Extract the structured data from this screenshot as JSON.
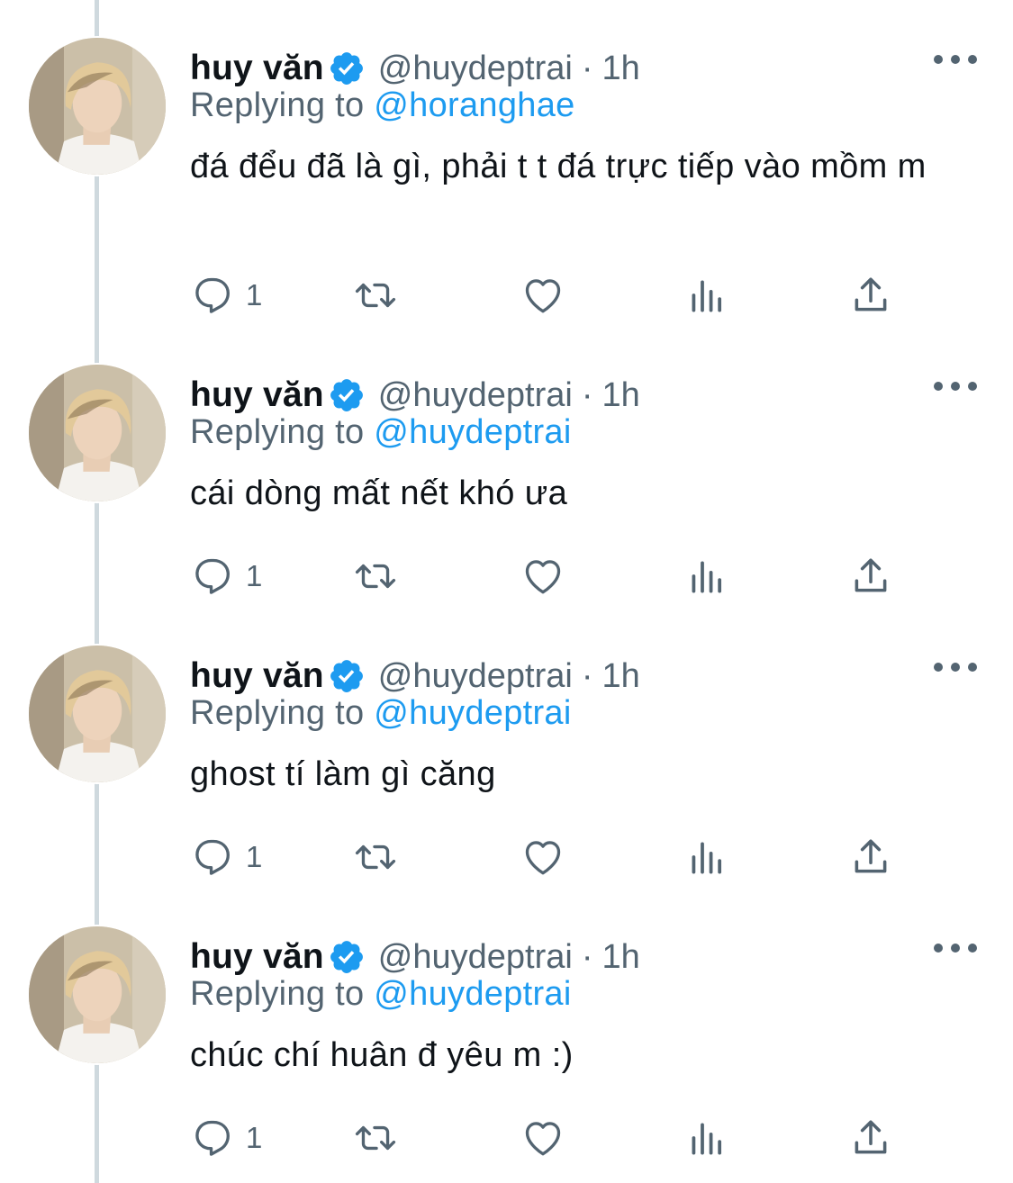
{
  "tweets": [
    {
      "display_name": "huy văn",
      "handle": "@huydeptrai",
      "separator": "·",
      "time": "1h",
      "replying_label": "Replying to",
      "replying_to": "@horanghae",
      "text": "đá đểu đã là gì, phải t t đá trực tiếp vào mồm m",
      "reply_count": "1"
    },
    {
      "display_name": "huy văn",
      "handle": "@huydeptrai",
      "separator": "·",
      "time": "1h",
      "replying_label": "Replying to",
      "replying_to": "@huydeptrai",
      "text": "cái dòng mất nết khó ưa",
      "reply_count": "1"
    },
    {
      "display_name": "huy văn",
      "handle": "@huydeptrai",
      "separator": "·",
      "time": "1h",
      "replying_label": "Replying to",
      "replying_to": "@huydeptrai",
      "text": "ghost tí làm gì căng",
      "reply_count": "1"
    },
    {
      "display_name": "huy văn",
      "handle": "@huydeptrai",
      "separator": "·",
      "time": "1h",
      "replying_label": "Replying to",
      "replying_to": "@huydeptrai",
      "text": "chúc chí huân đ yêu m :)",
      "reply_count": "1"
    }
  ],
  "icons": {
    "verified": "verified-badge-icon",
    "more": "more-dots-icon",
    "reply": "reply-bubble-icon",
    "retweet": "retweet-icon",
    "like": "heart-icon",
    "analytics": "bar-chart-icon",
    "share": "share-upload-icon"
  },
  "colors": {
    "accent": "#1d9bf0",
    "secondary_text": "#536471",
    "primary_text": "#0f1419",
    "thread_line": "#cfd9de"
  }
}
